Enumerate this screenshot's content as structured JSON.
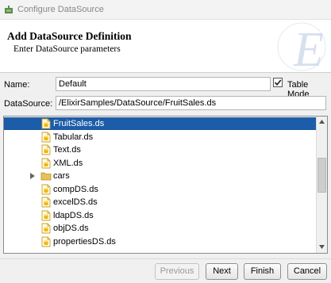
{
  "window": {
    "title": "Configure DataSource",
    "icon": "puzzle-icon"
  },
  "header": {
    "title": "Add DataSource Definition",
    "subtitle": "Enter DataSource parameters",
    "watermark": "E"
  },
  "form": {
    "name_label": "Name:",
    "name_value": "Default",
    "table_mode_label": "Table Mode",
    "table_mode_checked": true,
    "datasource_label": "DataSource:",
    "datasource_value": "/ElixirSamples/DataSource/FruitSales.ds"
  },
  "tree": {
    "items": [
      {
        "label": "FruitSales.ds",
        "icon": "datasource-file-icon",
        "selected": true
      },
      {
        "label": "Tabular.ds",
        "icon": "datasource-file-icon"
      },
      {
        "label": "Text.ds",
        "icon": "datasource-file-icon"
      },
      {
        "label": "XML.ds",
        "icon": "datasource-file-icon"
      },
      {
        "label": "cars",
        "icon": "folder-icon",
        "expandable": true
      },
      {
        "label": "compDS.ds",
        "icon": "datasource-file-icon"
      },
      {
        "label": "excelDS.ds",
        "icon": "datasource-file-icon"
      },
      {
        "label": "ldapDS.ds",
        "icon": "datasource-file-icon"
      },
      {
        "label": "objDS.ds",
        "icon": "datasource-file-icon"
      },
      {
        "label": "propertiesDS.ds",
        "icon": "datasource-file-icon"
      }
    ]
  },
  "buttons": {
    "previous": "Previous",
    "next": "Next",
    "finish": "Finish",
    "cancel": "Cancel"
  },
  "colors": {
    "selection": "#1d5ca8",
    "window_background": "#f0f0f0"
  }
}
